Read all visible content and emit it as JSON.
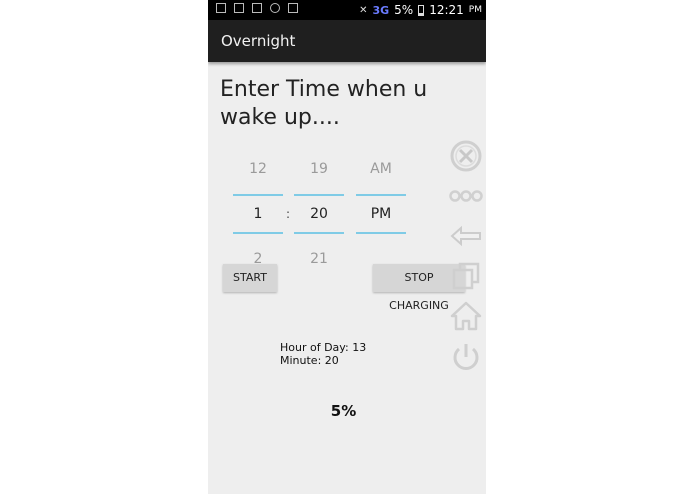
{
  "status_bar": {
    "network": "3G",
    "battery": "5%",
    "time": "12:21",
    "ampm": "PM"
  },
  "app": {
    "title": "Overnight"
  },
  "prompt": "Enter Time when u wake up....",
  "time_picker": {
    "hour": {
      "prev": "12",
      "selected": "1",
      "next": "2"
    },
    "separator": ":",
    "minute": {
      "prev": "19",
      "selected": "20",
      "next": "21"
    },
    "ampm": {
      "prev": "AM",
      "selected": "PM"
    }
  },
  "buttons": {
    "start": "START",
    "stop": "STOP CHARGING"
  },
  "info": {
    "hour_of_day": "Hour of Day: 13",
    "minute": "Minute: 20"
  },
  "battery_display": "5%",
  "floating_controls": {
    "icons": [
      "close-circle-icon",
      "more-dots-icon",
      "back-arrow-icon",
      "recent-apps-icon",
      "home-icon",
      "power-icon"
    ]
  }
}
